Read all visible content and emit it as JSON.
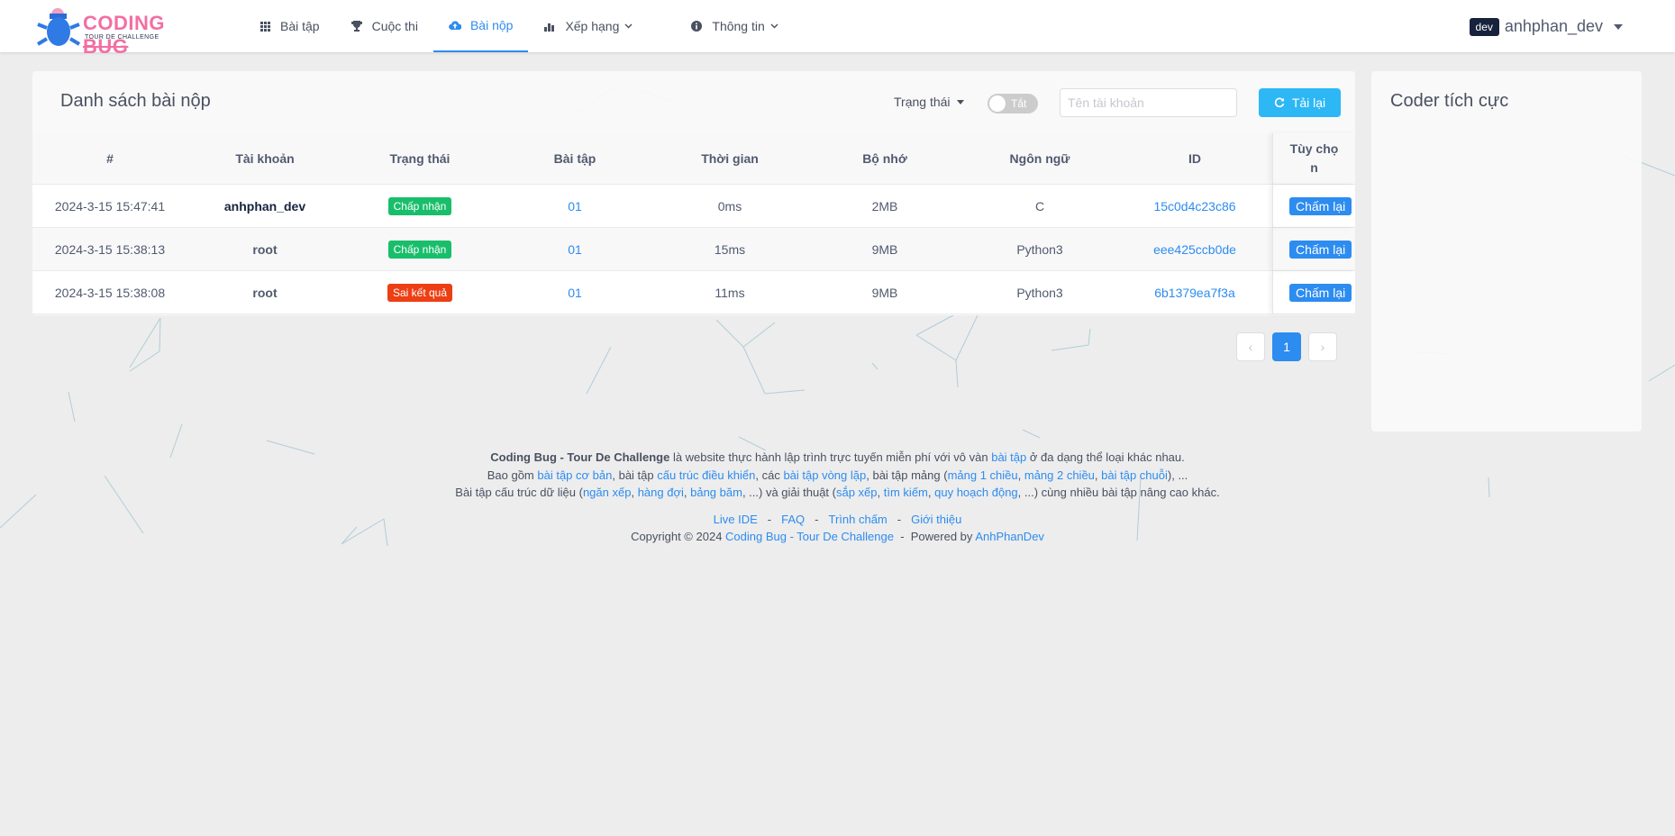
{
  "logo": {
    "main_a": "CODING ",
    "main_b": "BUG",
    "sub": "TOUR DE CHALLENGE"
  },
  "nav": [
    {
      "label": "Bài tập",
      "icon": "grid-icon"
    },
    {
      "label": "Cuộc thi",
      "icon": "trophy-icon"
    },
    {
      "label": "Bài nộp",
      "icon": "cloud-upload-icon",
      "active": true
    },
    {
      "label": "Xếp hạng",
      "icon": "bar-chart-icon"
    },
    {
      "label": "Thông tin",
      "icon": "info-icon"
    }
  ],
  "user": {
    "badge": "dev",
    "name": "anhphan_dev"
  },
  "submissions": {
    "title": "Danh sách bài nộp",
    "status_filter": "Trạng thái",
    "toggle_label": "Tắt",
    "search_placeholder": "Tên tài khoản",
    "reload_label": "Tải lại",
    "columns": [
      "#",
      "Tài khoản",
      "Trạng thái",
      "Bài tập",
      "Thời gian",
      "Bộ nhớ",
      "Ngôn ngữ",
      "ID"
    ],
    "option_col_a": "Tùy chọ",
    "option_col_b": "n",
    "rows": [
      {
        "time": "2024-3-15 15:47:41",
        "user": "anhphan_dev",
        "status": "Chấp nhận",
        "problem": "01",
        "runtime": "0ms",
        "memory": "2MB",
        "language": "C",
        "id": "15c0d4c23c86",
        "action": "Chấm lại"
      },
      {
        "time": "2024-3-15 15:38:13",
        "user": "root",
        "status": "Chấp nhận",
        "problem": "01",
        "runtime": "15ms",
        "memory": "9MB",
        "language": "Python3",
        "id": "eee425ccb0de",
        "action": "Chấm lại"
      },
      {
        "time": "2024-3-15 15:38:08",
        "user": "root",
        "status": "Sai kết quả",
        "problem": "01",
        "runtime": "11ms",
        "memory": "9MB",
        "language": "Python3",
        "id": "6b1379ea7f3a",
        "action": "Chấm lại"
      }
    ]
  },
  "pagination": {
    "prev": "‹",
    "current": "1",
    "next": "›"
  },
  "sidebar": {
    "title": "Coder tích cực"
  },
  "footer": {
    "l1": {
      "brand": "Coding Bug - Tour De Challenge",
      "t1": " là website thực hành lập trình trực tuyến miễn phí với vô vàn ",
      "link": "bài tập",
      "t2": " ở đa dạng thể loại khác nhau."
    },
    "l2": {
      "t0": "Bao gồm ",
      "a": "bài tập cơ bản",
      "t1": ", bài tập ",
      "b": "cấu trúc điều khiển",
      "t2": ", các ",
      "c": "bài tập vòng lặp",
      "t3": ", bài tập mảng (",
      "d": "mảng 1 chiều",
      "t4": ", ",
      "e": "mảng 2 chiều",
      "t5": ", ",
      "f": "bài tập chuỗi",
      "t6": "), ..."
    },
    "l3": {
      "t0": "Bài tập cấu trúc dữ liệu (",
      "a": "ngăn xếp",
      "t1": ", ",
      "b": "hàng đợi",
      "t2": ", ",
      "c": "bảng băm",
      "t3": ", ...) và giải thuật (",
      "d": "sắp xếp",
      "t4": ", ",
      "e": "tìm kiếm",
      "t5": ", ",
      "f": "quy hoạch động",
      "t6": ", ...) cùng nhiều bài tập nâng cao khác."
    },
    "links": [
      "Live IDE",
      "FAQ",
      "Trình chấm",
      "Giới thiệu"
    ],
    "sep": "-",
    "copyright": "Copyright © 2024 ",
    "copyright_link": "Coding Bug - Tour De Challenge",
    "powered": "  -  Powered by ",
    "powered_link": "AnhPhanDev"
  }
}
